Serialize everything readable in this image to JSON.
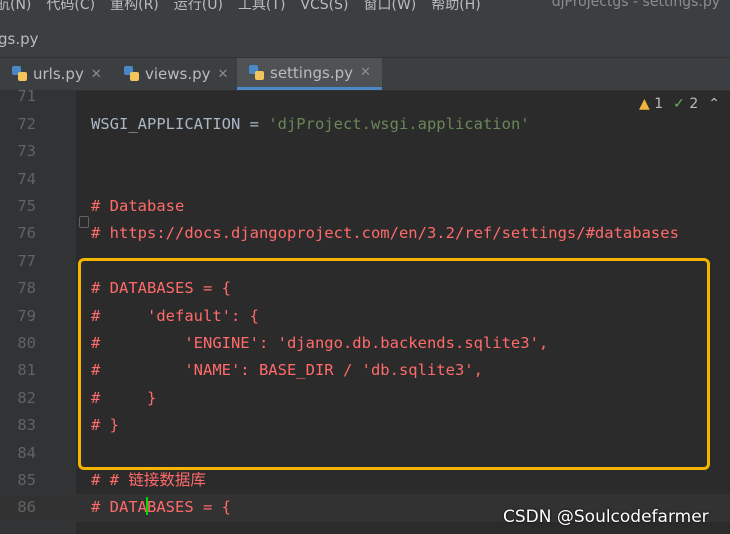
{
  "menu": {
    "items": [
      "航(N)",
      "代码(C)",
      "重构(R)",
      "运行(U)",
      "工具(T)",
      "VCS(S)",
      "窗口(W)",
      "帮助(H)"
    ],
    "window_title": "djProjectgs - settings.py"
  },
  "breadcrumb": "gs.py",
  "tabs": [
    {
      "label": "urls.py",
      "active": false
    },
    {
      "label": "views.py",
      "active": false
    },
    {
      "label": "settings.py",
      "active": true
    }
  ],
  "inspections": {
    "warnings": "1",
    "weak_warnings": "2"
  },
  "lines": [
    {
      "num": "71",
      "text": ""
    },
    {
      "num": "72",
      "text": "WSGI_APPLICATION = 'djProject.wsgi.application'"
    },
    {
      "num": "73",
      "text": ""
    },
    {
      "num": "74",
      "text": ""
    },
    {
      "num": "75",
      "text": "# Database"
    },
    {
      "num": "76",
      "text": "# https://docs.djangoproject.com/en/3.2/ref/settings/#databases"
    },
    {
      "num": "77",
      "text": ""
    },
    {
      "num": "78",
      "text": "# DATABASES = {"
    },
    {
      "num": "79",
      "text": "#     'default': {"
    },
    {
      "num": "80",
      "text": "#         'ENGINE': 'django.db.backends.sqlite3',"
    },
    {
      "num": "81",
      "text": "#         'NAME': BASE_DIR / 'db.sqlite3',"
    },
    {
      "num": "82",
      "text": "#     }"
    },
    {
      "num": "83",
      "text": "# }"
    },
    {
      "num": "84",
      "text": ""
    },
    {
      "num": "85",
      "text": "# # 链接数据库"
    },
    {
      "num": "86",
      "text": "# DATABASES = {"
    }
  ],
  "watermark": "CSDN @Soulcodefarmer",
  "colors": {
    "comment": "#ff6b6b",
    "string": "#6a8759",
    "highlight_box": "#f5b400",
    "active_tab_underline": "#4a88c7"
  }
}
